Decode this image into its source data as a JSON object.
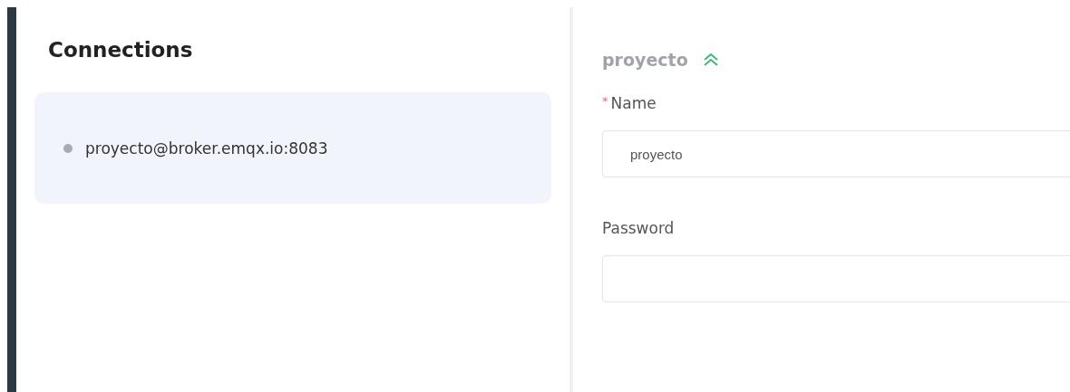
{
  "sidebar": {
    "title": "Connections",
    "items": [
      {
        "label": "proyecto@broker.emqx.io:8083",
        "selected": true,
        "color": "#a8abb5"
      }
    ]
  },
  "form": {
    "title": "proyecto",
    "fields": [
      {
        "label": "Name",
        "required_mark": "*",
        "value": "proyecto"
      },
      {
        "label": "Password"
      }
    ]
  }
}
